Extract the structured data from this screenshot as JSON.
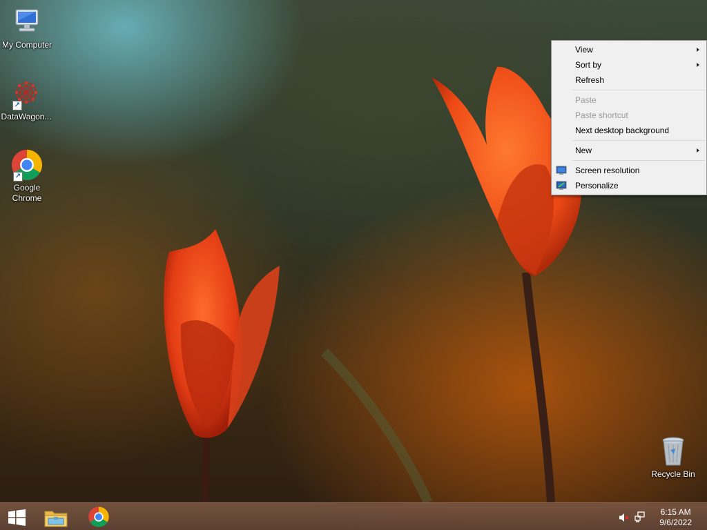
{
  "desktop": {
    "icons": [
      {
        "label": "My Computer",
        "icon": "computer-icon"
      },
      {
        "label": "DataWagon...",
        "icon": "datawagon-icon"
      },
      {
        "label": "Google Chrome",
        "icon": "chrome-icon"
      },
      {
        "label": "Recycle Bin",
        "icon": "recycle-bin-icon"
      }
    ]
  },
  "context_menu": {
    "items": [
      {
        "label": "View",
        "submenu": true,
        "enabled": true
      },
      {
        "label": "Sort by",
        "submenu": true,
        "enabled": true
      },
      {
        "label": "Refresh",
        "submenu": false,
        "enabled": true
      },
      {
        "label": "Paste",
        "submenu": false,
        "enabled": false
      },
      {
        "label": "Paste shortcut",
        "submenu": false,
        "enabled": false
      },
      {
        "label": "Next desktop background",
        "submenu": false,
        "enabled": true
      },
      {
        "label": "New",
        "submenu": true,
        "enabled": true
      },
      {
        "label": "Screen resolution",
        "submenu": false,
        "enabled": true,
        "icon": "screen-resolution-icon"
      },
      {
        "label": "Personalize",
        "submenu": false,
        "enabled": true,
        "icon": "personalize-icon"
      }
    ]
  },
  "taskbar": {
    "buttons": [
      {
        "name": "start",
        "icon": "windows-start-icon"
      },
      {
        "name": "file-explorer",
        "icon": "folder-icon"
      },
      {
        "name": "chrome",
        "icon": "chrome-icon"
      }
    ],
    "tray": {
      "volume_icon": "volume-muted-icon",
      "network_icon": "network-icon",
      "time": "6:15 AM",
      "date": "9/6/2022"
    }
  },
  "colors": {
    "menu_background": "#f0f0f0",
    "menu_disabled_text": "#9a9a9a",
    "flower": "#e8451a",
    "taskbar": "#6e4c3c"
  }
}
